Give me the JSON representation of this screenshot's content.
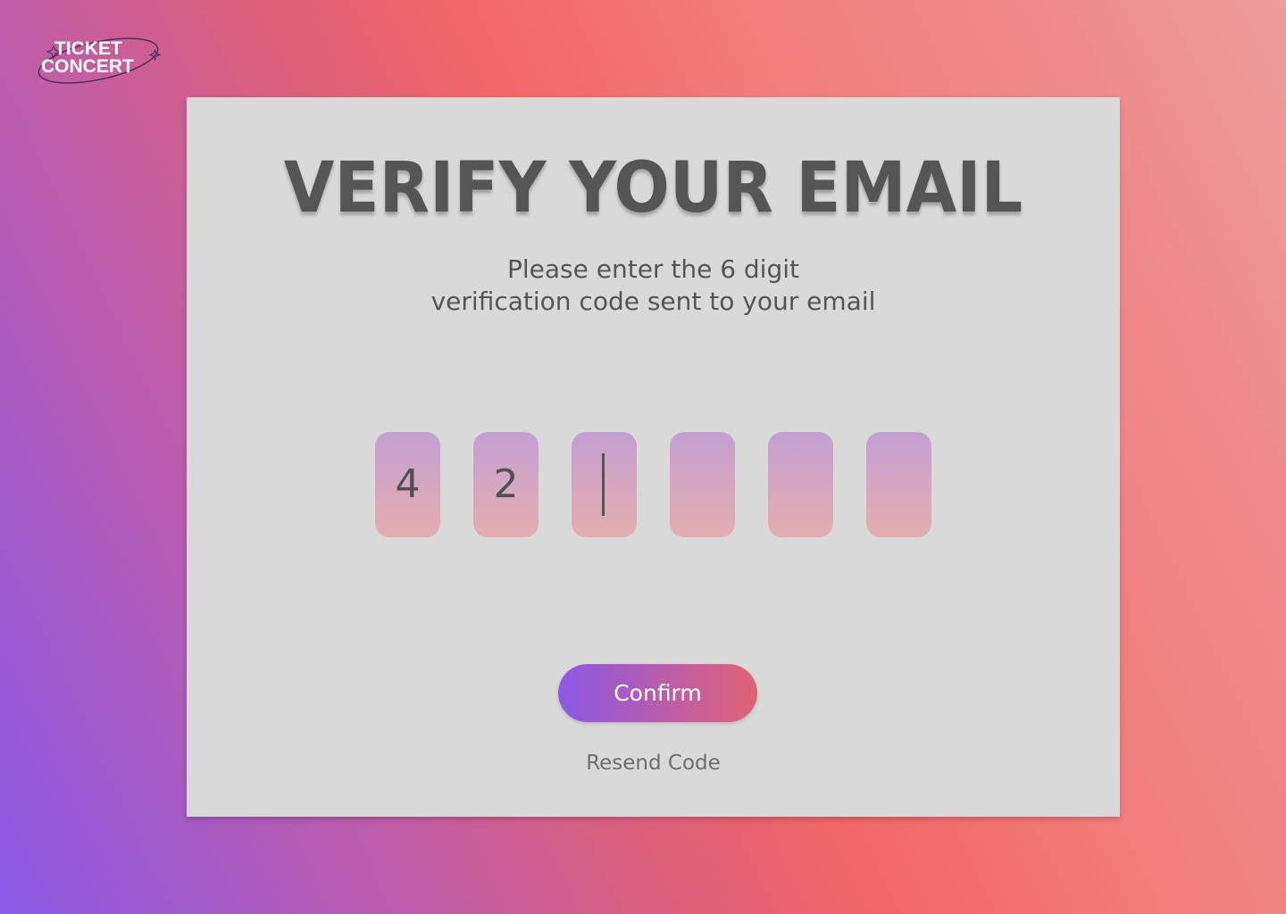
{
  "brand": {
    "logo_line1": "TICKET",
    "logo_line2": "CONCERT"
  },
  "verify": {
    "title": "VERIFY YOUR EMAIL",
    "subtitle_line1": "Please enter the 6 digit",
    "subtitle_line2": "verification code sent to your email",
    "code_digits": [
      "4",
      "2",
      "",
      "",
      "",
      ""
    ],
    "active_index": 2,
    "confirm_label": "Confirm",
    "resend_label": "Resend Code"
  },
  "colors": {
    "text_dark": "#555555",
    "card_bg": "#d9d9d9",
    "button_gradient_start": "#8c5ae6",
    "button_gradient_end": "#e16373"
  }
}
